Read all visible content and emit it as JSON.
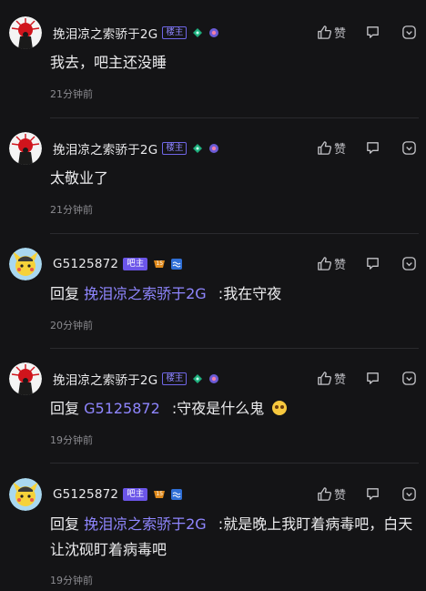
{
  "comments": [
    {
      "avatar": "flag-avatar",
      "username": "挽泪凉之索骄于2G",
      "badge": "楼主",
      "badge_kind": "host",
      "like_label": "赞",
      "text": "我去，吧主还没睡",
      "time": "21分钟前"
    },
    {
      "avatar": "flag-avatar",
      "username": "挽泪凉之索骄于2G",
      "badge": "楼主",
      "badge_kind": "host",
      "like_label": "赞",
      "text": "太敬业了",
      "time": "21分钟前"
    },
    {
      "avatar": "cartoon-avatar",
      "username": "G5125872",
      "badge": "吧主",
      "badge_kind": "owner",
      "level": "15",
      "like_label": "赞",
      "reply_word": "回复",
      "reply_to": "挽泪凉之索骄于2G",
      "text": ":我在守夜",
      "time": "20分钟前"
    },
    {
      "avatar": "flag-avatar",
      "username": "挽泪凉之索骄于2G",
      "badge": "楼主",
      "badge_kind": "host",
      "like_label": "赞",
      "reply_word": "回复",
      "reply_to": "G5125872",
      "text": ":守夜是什么鬼",
      "time": "19分钟前"
    },
    {
      "avatar": "cartoon-avatar",
      "username": "G5125872",
      "badge": "吧主",
      "badge_kind": "owner",
      "level": "15",
      "like_label": "赞",
      "reply_word": "回复",
      "reply_to": "挽泪凉之索骄于2G",
      "text": ":就是晚上我盯着病毒吧，白天让沈砚盯着病毒吧",
      "time": "19分钟前"
    }
  ],
  "colors": {
    "background": "#141416",
    "mention": "#8f86ff",
    "owner_badge": "#6b55e8",
    "muted": "#8b8b90"
  }
}
